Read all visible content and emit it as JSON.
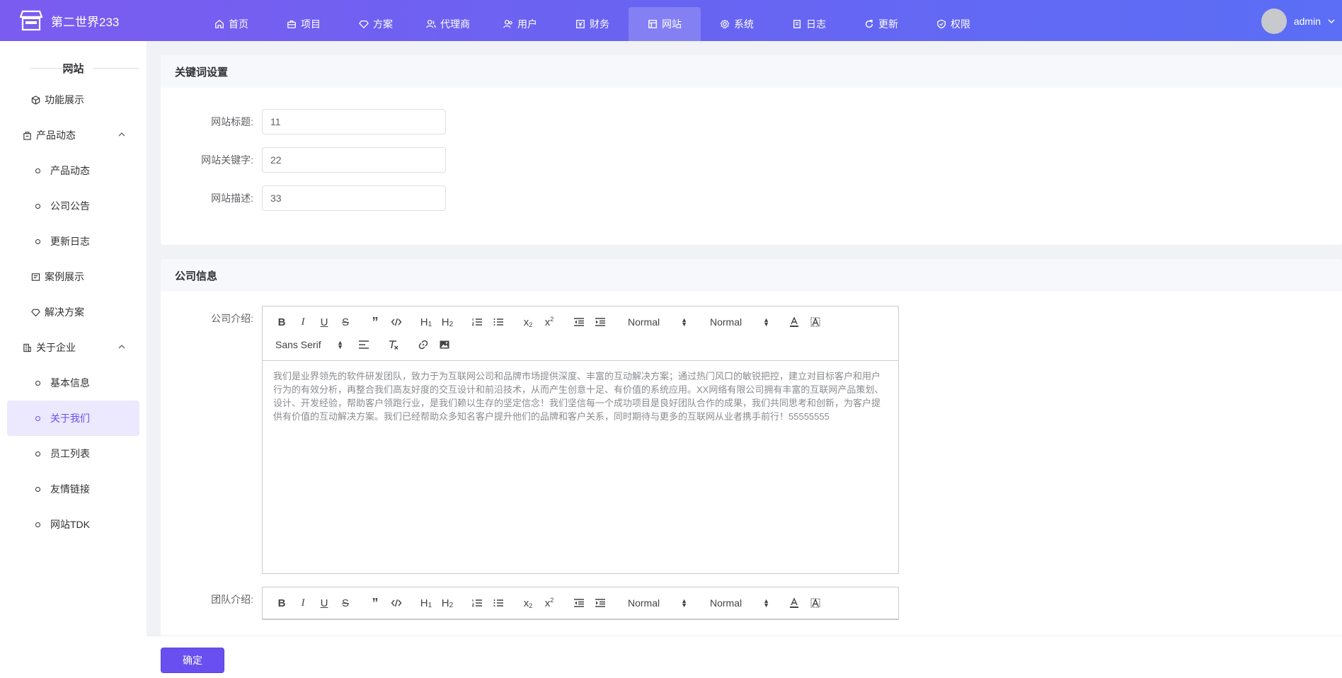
{
  "header": {
    "brand": "第二世界233",
    "nav": [
      {
        "label": "首页",
        "icon": "home-icon"
      },
      {
        "label": "项目",
        "icon": "briefcase-icon"
      },
      {
        "label": "方案",
        "icon": "diamond-icon"
      },
      {
        "label": "代理商",
        "icon": "agents-icon"
      },
      {
        "label": "用户",
        "icon": "users-icon"
      },
      {
        "label": "财务",
        "icon": "finance-icon"
      },
      {
        "label": "网站",
        "icon": "website-icon"
      },
      {
        "label": "系统",
        "icon": "gear-icon"
      },
      {
        "label": "日志",
        "icon": "log-icon"
      },
      {
        "label": "更新",
        "icon": "refresh-icon"
      },
      {
        "label": "权限",
        "icon": "shield-icon"
      }
    ],
    "active_nav": "网站",
    "username": "admin"
  },
  "sidebar": {
    "title": "网站",
    "items": [
      {
        "label": "功能展示",
        "type": "item",
        "icon": "cube-icon"
      },
      {
        "label": "产品动态",
        "type": "group",
        "icon": "bag-icon"
      },
      {
        "label": "产品动态",
        "type": "sub"
      },
      {
        "label": "公司公告",
        "type": "sub"
      },
      {
        "label": "更新日志",
        "type": "sub"
      },
      {
        "label": "案例展示",
        "type": "item",
        "icon": "case-icon"
      },
      {
        "label": "解决方案",
        "type": "item",
        "icon": "diamond-icon"
      },
      {
        "label": "关于企业",
        "type": "group",
        "icon": "building-icon"
      },
      {
        "label": "基本信息",
        "type": "sub"
      },
      {
        "label": "关于我们",
        "type": "sub",
        "active": true
      },
      {
        "label": "员工列表",
        "type": "sub"
      },
      {
        "label": "友情链接",
        "type": "sub"
      },
      {
        "label": "网站TDK",
        "type": "sub"
      }
    ]
  },
  "keywords_card": {
    "title": "关键词设置",
    "fields": [
      {
        "label": "网站标题:",
        "value": "11"
      },
      {
        "label": "网站关键字:",
        "value": "22"
      },
      {
        "label": "网站描述:",
        "value": "33"
      }
    ]
  },
  "company_card": {
    "title": "公司信息",
    "intro_label": "公司介绍:",
    "team_label": "团队介绍:",
    "toolbar": {
      "size_picker": "Normal",
      "header_picker": "Normal",
      "font_picker": "Sans Serif"
    },
    "intro_text": "我们是业界领先的软件研发团队，致力于为互联网公司和品牌市场提供深度、丰富的互动解决方案；通过热门风口的敏锐把控，建立对目标客户和用户行为的有效分析，再整合我们高友好度的交互设计和前沿技术，从而产生创意十足、有价值的系统应用。XX网络有限公司拥有丰富的互联网产品策划、设计、开发经验，帮助客户领跑行业，是我们赖以生存的坚定信念！我们坚信每一个成功项目是良好团队合作的成果，我们共同思考和创新，为客户提供有价值的互动解决方案。我们已经帮助众多知名客户提升他们的品牌和客户关系，同时期待与更多的互联网从业者携手前行！55555555"
  },
  "footer": {
    "confirm_label": "确定"
  },
  "colors": {
    "primary": "#6a4ff0",
    "header_gradient_start": "#7b5cf0",
    "header_gradient_end": "#5b6ef5",
    "active_bg": "#ece8fd"
  }
}
